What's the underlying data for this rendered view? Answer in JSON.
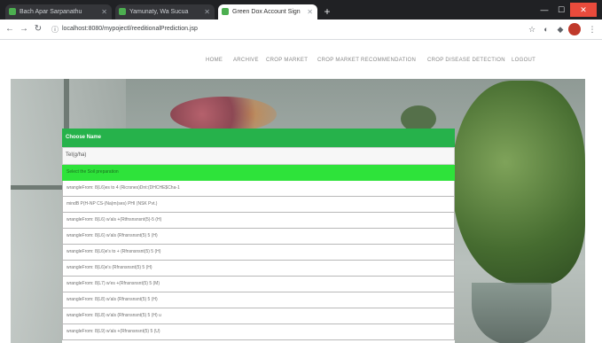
{
  "browser": {
    "tabs": [
      {
        "label": "Bach Apar Sarpanathu",
        "active": false
      },
      {
        "label": "Yamunaty, Wa Sucua",
        "active": false
      },
      {
        "label": "Green Dox Account Sign",
        "active": true
      }
    ],
    "url": "localhost:8080/mypojectl/reeditionalPrediction.jsp"
  },
  "site_nav": {
    "links": [
      "HOME",
      "ARCHIVE",
      "CROP MARKET",
      "CROP MARKET RECOMMENDATION",
      "CROP DISEASE DETECTION",
      "LOGOUT"
    ]
  },
  "panel": {
    "title": "Choose Name",
    "select_value": "Tel(g/ha)",
    "options": [
      {
        "label": "Select the Soil preparation",
        "highlighted": true
      },
      {
        "label": "wrangleFrom: 8(L6)es to 4 (Ricrsnes)Dnt:(DHCHE$Cha-1",
        "highlighted": false
      },
      {
        "label": "mindB P(H-NP CS-(Na)m(ses) PHI (NSK Pvt.)",
        "highlighted": false
      },
      {
        "label": "wrangleFrom: 8(L6) w'als +(Rtfnsnsnsnt(5)-5 (H)",
        "highlighted": false
      },
      {
        "label": "wrangleFrom: 8(L6) w'als (Rfnsnsnsnt(5) 5 (H)",
        "highlighted": false
      },
      {
        "label": "wrangleFrom: 8(L6)e's to + (Rfnsnsnsnt(5) 5 (H)",
        "highlighted": false
      },
      {
        "label": "wrangleFrom: 8(L6)e's (Rfnsnsnsnt(5) 5 (H)",
        "highlighted": false
      },
      {
        "label": "wrangleFrom: 8(L7) w'es +(Rfnsnsnsnt(5) 5 (M)",
        "highlighted": false
      },
      {
        "label": "wrangleFrom: 8(L8) w'als (Rfnsnsnsnt(5) 5 (H)",
        "highlighted": false
      },
      {
        "label": "wrangleFrom: 8(L8) w'als (Rfnsnsnsnt(5) 5 (H) u",
        "highlighted": false
      },
      {
        "label": "wrangleFrom: 8(L9) w'als +(Rfnsnsnsnt(5) 5 (U)",
        "highlighted": false
      }
    ]
  },
  "colors": {
    "header_green": "#26b24b",
    "highlight_green": "#2ee33a"
  }
}
